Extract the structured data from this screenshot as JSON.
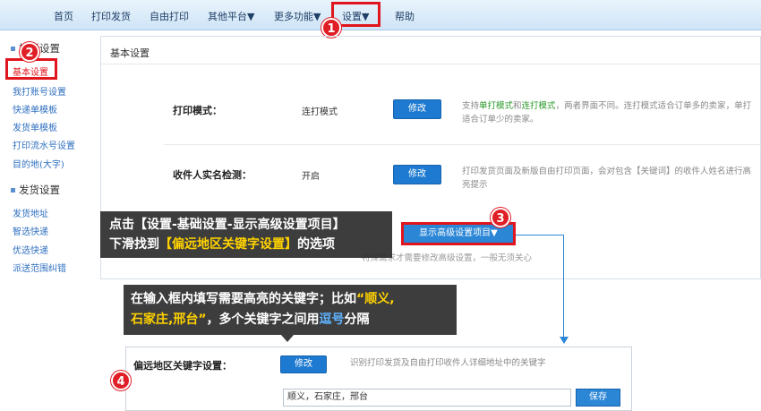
{
  "nav": {
    "items": [
      "首页",
      "打印发货",
      "自由打印",
      "其他平台▼",
      "更多功能▼",
      "设置▼",
      "帮助"
    ]
  },
  "badges": [
    "1",
    "2",
    "3",
    "4"
  ],
  "sidebar": {
    "group1": "模板设置",
    "group1_items": [
      "基本设置",
      "我打账号设置",
      "快递单模板",
      "发货单模板",
      "打印流水号设置",
      "目的地(大字)"
    ],
    "group2": "发货设置",
    "group2_items": [
      "发货地址",
      "智选快递",
      "优选快递",
      "派送范围纠错"
    ]
  },
  "main": {
    "title": "基本设置",
    "rows": [
      {
        "label": "打印模式：",
        "value": "连打模式",
        "button": "修改",
        "desc_pre": "支持",
        "desc_g1": "单打模式",
        "desc_mid": "和",
        "desc_g2": "连打模式",
        "desc_post": "，两者界面不同。连打模式适合订单多的卖家，单打适合订单少的卖家。"
      },
      {
        "label": "收件人实名检测：",
        "value": "开启",
        "button": "修改",
        "desc": "打印发货页面及新版自由打印页面，会对包含【关键词】的收件人姓名进行高亮提示"
      }
    ],
    "advanced_button": "显示高级设置项目▼",
    "advanced_tip": "特殊需求才需要修改高级设置，一般无须关心"
  },
  "callout1": {
    "line1": "点击【设置-基础设置-显示高级设置项目】",
    "line2_pre": "下滑找到",
    "line2_hl": "【偏远地区关键字设置】",
    "line2_post": "的选项"
  },
  "callout2": {
    "line1_pre": "在输入框内填写需要高亮的关键字；比如",
    "line1_hl": "“顺义,",
    "line2_hl": "石家庄,邢台”",
    "line2_mid": "，多个关键字之间用",
    "line2_blue": "逗号",
    "line2_post": "分隔"
  },
  "keyword": {
    "label": "偏远地区关键字设置：",
    "button": "修改",
    "desc": "识别打印发货及自由打印收件人详细地址中的关键字",
    "input_value": "顺义，石家庄，邢台",
    "save": "保存"
  },
  "colors": {
    "accent": "#1e7ad0",
    "highlight_red": "#e0151d",
    "callout_yellow": "#ffd200"
  }
}
